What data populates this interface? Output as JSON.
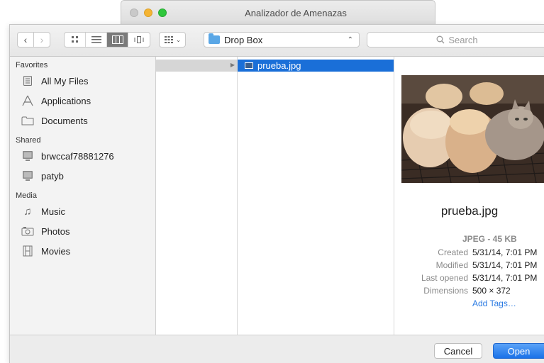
{
  "window": {
    "title": "Analizador de Amenazas"
  },
  "toolbar": {
    "back_icon": "chevron-left-icon",
    "forward_icon": "chevron-right-icon",
    "location": "Drop Box",
    "search_placeholder": "Search"
  },
  "sidebar": {
    "sections": [
      {
        "title": "Favorites",
        "items": [
          {
            "label": "All My Files",
            "icon": "all-files-icon"
          },
          {
            "label": "Applications",
            "icon": "applications-icon"
          },
          {
            "label": "Documents",
            "icon": "folder-icon"
          }
        ]
      },
      {
        "title": "Shared",
        "items": [
          {
            "label": "brwccaf78881276",
            "icon": "computer-icon"
          },
          {
            "label": "patyb",
            "icon": "computer-icon"
          }
        ]
      },
      {
        "title": "Media",
        "items": [
          {
            "label": "Music",
            "icon": "music-icon"
          },
          {
            "label": "Photos",
            "icon": "camera-icon"
          },
          {
            "label": "Movies",
            "icon": "film-icon"
          }
        ]
      }
    ]
  },
  "browser": {
    "selected_file": "prueba.jpg"
  },
  "preview": {
    "name": "prueba.jpg",
    "kind": "JPEG - 45 KB",
    "meta": [
      {
        "key": "Created",
        "value": "5/31/14, 7:01 PM"
      },
      {
        "key": "Modified",
        "value": "5/31/14, 7:01 PM"
      },
      {
        "key": "Last opened",
        "value": "5/31/14, 7:01 PM"
      },
      {
        "key": "Dimensions",
        "value": "500 × 372"
      }
    ],
    "add_tags": "Add Tags…"
  },
  "footer": {
    "cancel": "Cancel",
    "open": "Open"
  },
  "colors": {
    "accent": "#1a6fd8",
    "open_button": "#1a72e8"
  }
}
